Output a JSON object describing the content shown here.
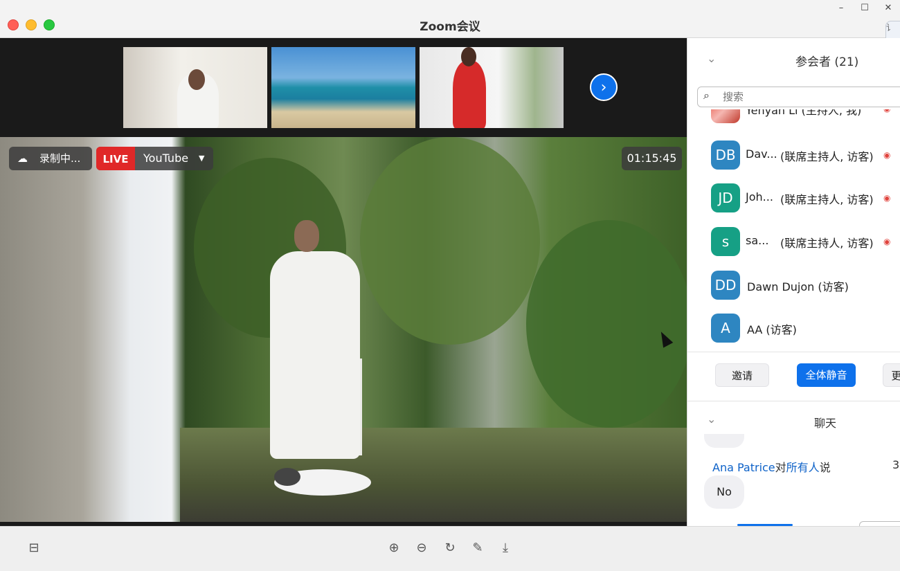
{
  "window": {
    "title": "Zoom会议",
    "controls": {
      "minimize": "–",
      "maximize": "☐",
      "close": "✕"
    },
    "side_tab": "讠"
  },
  "video": {
    "next_button_icon": "›",
    "recording": {
      "label": "录制中...",
      "icon": "cloud-icon"
    },
    "live": {
      "tag": "LIVE",
      "platform": "YouTube",
      "caret": "▼"
    },
    "timer": "01:15:45"
  },
  "participants": {
    "title": "参会者 (21)",
    "search_placeholder": "搜索",
    "list": [
      {
        "initials": "",
        "name": "Yehyan Li (主持人, 我)",
        "role": "",
        "color": "#c0392b"
      },
      {
        "initials": "DB",
        "name": "Dav...",
        "role": "(联席主持人, 访客)",
        "color": "#2e86c1"
      },
      {
        "initials": "JD",
        "name": "Joh...",
        "role": "(联席主持人, 访客)",
        "color": "#16a085"
      },
      {
        "initials": "s",
        "name": "sa...",
        "role": "(联席主持人, 访客)",
        "color": "#16a085"
      },
      {
        "initials": "DD",
        "name": "Dawn Dujon (访客)",
        "role": "",
        "color": "#2e86c1"
      },
      {
        "initials": "A",
        "name": "AA (访客)",
        "role": "",
        "color": "#2e86c1"
      }
    ],
    "actions": {
      "invite": "邀请",
      "mute_all": "全体静音",
      "more": "更"
    }
  },
  "chat": {
    "title": "聊天",
    "message": {
      "sender": "Ana Patrice",
      "to_word": "对",
      "recipients": "所有人",
      "says": "说",
      "time": "3",
      "text": "No"
    }
  },
  "toolbar": {
    "layout_icon": "⊟",
    "zoom_in_icon": "⊕",
    "zoom_out_icon": "⊖",
    "rotate_icon": "↻",
    "annotate_icon": "✎",
    "download_icon": "⤓"
  }
}
